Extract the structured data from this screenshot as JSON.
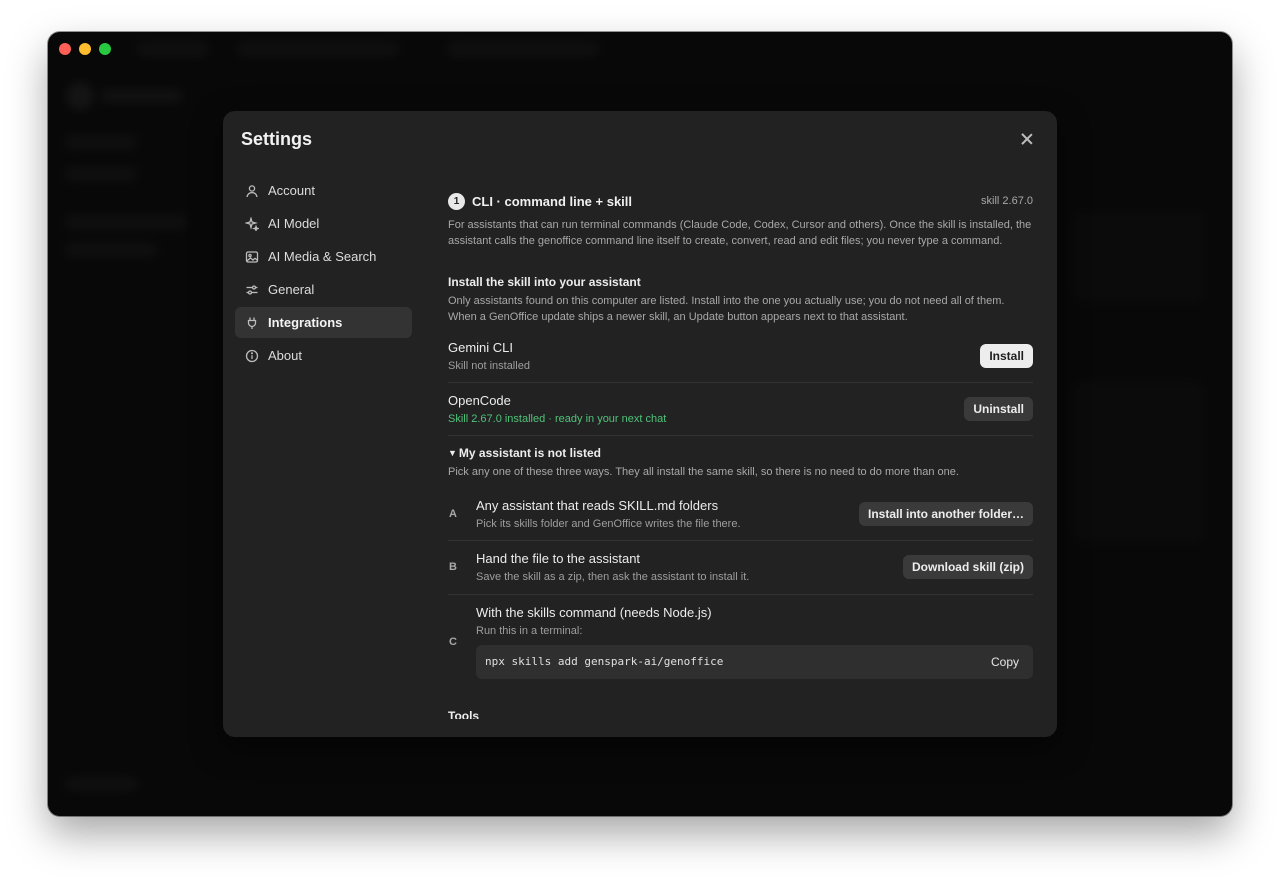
{
  "dialog": {
    "title": "Settings"
  },
  "nav": {
    "items": [
      {
        "label": "Account",
        "icon": "user-icon"
      },
      {
        "label": "AI Model",
        "icon": "sparkle-icon"
      },
      {
        "label": "AI Media & Search",
        "icon": "image-icon"
      },
      {
        "label": "General",
        "icon": "sliders-icon"
      },
      {
        "label": "Integrations",
        "icon": "plug-icon",
        "active": true
      },
      {
        "label": "About",
        "icon": "info-icon"
      }
    ]
  },
  "cli": {
    "badge": "1",
    "title": "CLI · command line + skill",
    "version": "skill 2.67.0",
    "description": "For assistants that can run terminal commands (Claude Code, Codex, Cursor and others). Once the skill is installed, the assistant calls the genoffice command line itself to create, convert, read and edit files; you never type a command."
  },
  "install": {
    "heading": "Install the skill into your assistant",
    "description": "Only assistants found on this computer are listed. Install into the one you actually use; you do not need all of them. When a GenOffice update ships a newer skill, an Update button appears next to that assistant.",
    "assistants": [
      {
        "name": "Gemini CLI",
        "status": "Skill not installed",
        "button": "Install"
      },
      {
        "name": "OpenCode",
        "status": "Skill 2.67.0 installed · ready in your next chat",
        "button": "Uninstall"
      }
    ]
  },
  "not_listed": {
    "heading": "My assistant is not listed",
    "triangle": "▼",
    "description": "Pick any one of these three ways. They all install the same skill, so there is no need to do more than one.",
    "options": [
      {
        "letter": "A",
        "title": "Any assistant that reads SKILL.md folders",
        "sub": "Pick its skills folder and GenOffice writes the file there.",
        "button": "Install into another folder…"
      },
      {
        "letter": "B",
        "title": "Hand the file to the assistant",
        "sub": "Save the skill as a zip, then ask the assistant to install it.",
        "button": "Download skill (zip)"
      },
      {
        "letter": "C",
        "title": "With the skills command (needs Node.js)",
        "sub": "Run this in a terminal:",
        "command": "npx skills add genspark-ai/genoffice",
        "copy": "Copy"
      }
    ]
  },
  "next_section_peek": "Tools"
}
